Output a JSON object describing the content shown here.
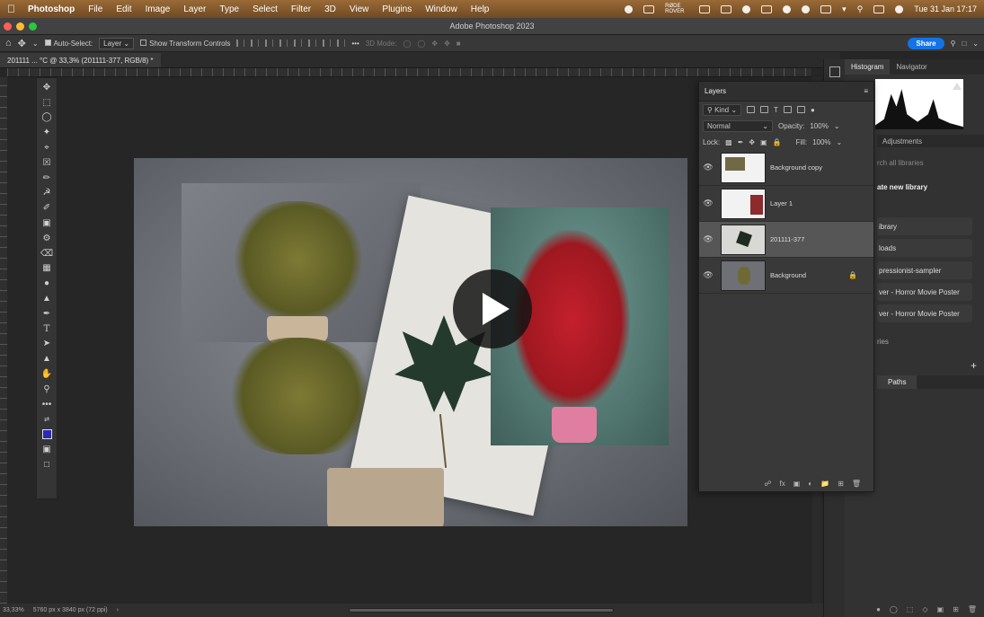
{
  "menubar": {
    "items": [
      "Photoshop",
      "File",
      "Edit",
      "Image",
      "Layer",
      "Type",
      "Select",
      "Filter",
      "3D",
      "View",
      "Plugins",
      "Window",
      "Help"
    ],
    "rode_label": "RØDE ROVER",
    "clock": "Tue 31 Jan  17:17"
  },
  "window": {
    "title": "Adobe Photoshop 2023"
  },
  "options": {
    "auto_select_label": "Auto-Select:",
    "auto_select_value": "Layer",
    "transform_label": "Show Transform Controls",
    "mode_label": "3D Mode:",
    "share_label": "Share"
  },
  "tab": {
    "label": "201111 ... °C @ 33,3% (201111-377, RGB/8) *"
  },
  "status": {
    "zoom": "33,33%",
    "doc_size": "5760 px x 3840 px (72 ppi)"
  },
  "layers_panel": {
    "title": "Layers",
    "filter_kind": "Kind",
    "blend_mode": "Normal",
    "opacity_label": "Opacity:",
    "opacity_value": "100%",
    "lock_label": "Lock:",
    "fill_label": "Fill:",
    "fill_value": "100%",
    "layers": [
      {
        "name": "Background copy",
        "selected": false,
        "locked": false
      },
      {
        "name": "Layer 1",
        "selected": false,
        "locked": false
      },
      {
        "name": "201111-377",
        "selected": true,
        "locked": false
      },
      {
        "name": "Background",
        "selected": false,
        "locked": true
      }
    ]
  },
  "right_dock": {
    "tabs": [
      "Histogram",
      "Navigator"
    ],
    "adjust_tabs": [
      "Adjustments"
    ],
    "search_placeholder": "rch all libraries",
    "create_label": "ate new library",
    "libraries": [
      "ibrary",
      "loads",
      "pressionist-sampler",
      "ver - Horror Movie Poster",
      "ver - Horror Movie Poster"
    ],
    "section_label": "ries",
    "paths_tab": "Paths"
  },
  "colors": {
    "foreground": "#2a2ab8",
    "accent": "#1473e6"
  }
}
